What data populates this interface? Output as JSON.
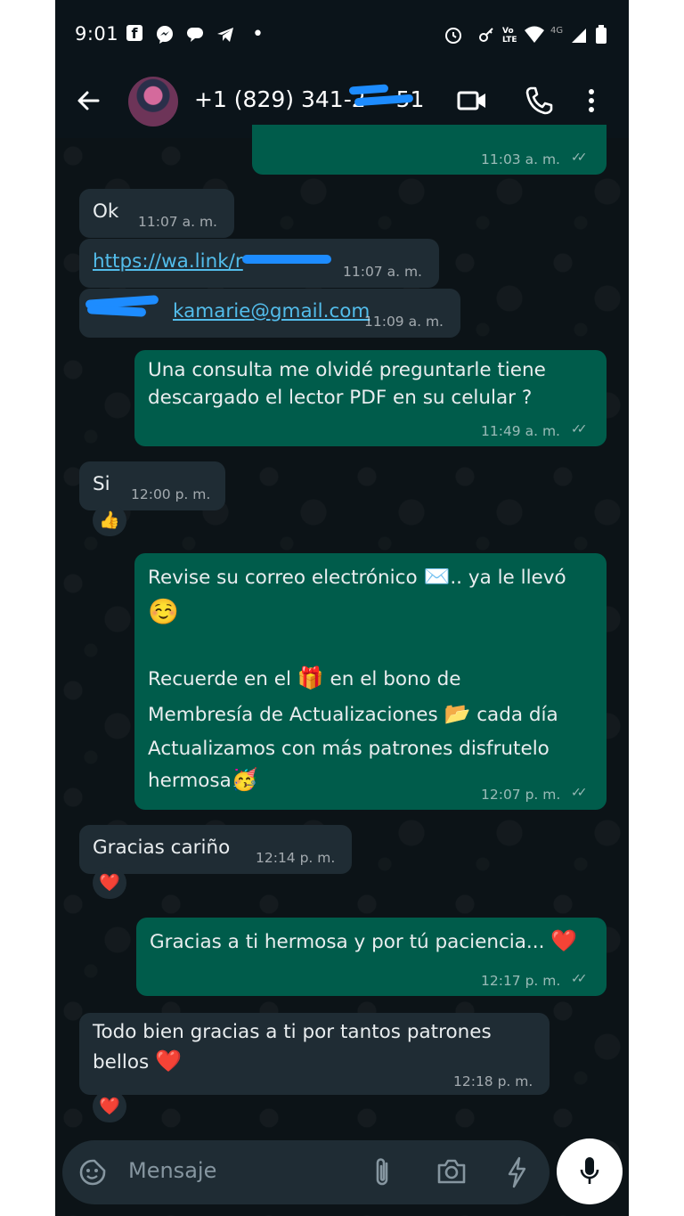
{
  "status_bar": {
    "time": "9:01",
    "network": "4G"
  },
  "header": {
    "contact_name": "+1 (829) 341-2",
    "contact_name_tail": "51"
  },
  "messages": [
    {
      "time": "11:03 a. m."
    },
    {
      "text": "Ok",
      "time": "11:07 a. m."
    },
    {
      "text": "https://wa.link/r",
      "time": "11:07 a. m."
    },
    {
      "text": "kamarie@gmail.com",
      "time": "11:09 a. m."
    },
    {
      "text": "Una consulta me olvidé preguntarle tiene\ndescargado el lector PDF en su celular ?",
      "time": "11:49 a. m."
    },
    {
      "text": "Si",
      "time": "12:00 p. m.",
      "reaction": "👍"
    },
    {
      "line1": "Revise su correo electrónico ",
      "line1_tail": ".. ya le llevó",
      "line2": "Recuerde en el ",
      "line2_tail": " en el bono de",
      "line3": "Membresía de Actualizaciones ",
      "line3_tail": " cada día",
      "line4": "Actualizamos con más patrones disfrutelo",
      "line5": "hermosa",
      "emoji_envelope": "✉️",
      "emoji_smile": "☺️",
      "emoji_gift": "🎁",
      "emoji_folder": "📂",
      "emoji_party": "🥳",
      "time": "12:07 p. m."
    },
    {
      "text": "Gracias cariño",
      "time": "12:14 p. m.",
      "reaction": "❤️"
    },
    {
      "text": "Gracias a ti hermosa y por tú paciencia... ",
      "emoji": "❤️",
      "time": "12:17 p. m."
    },
    {
      "line1": "Todo bien gracias a ti por tantos patrones",
      "line2": "bellos ",
      "emoji": "❤️",
      "time": "12:18 p. m.",
      "reaction": "❤️"
    }
  ],
  "composer": {
    "placeholder": "Mensaje"
  },
  "colors": {
    "incoming": "#1f2c34",
    "outgoing": "#005c4b",
    "link": "#53bdeb",
    "redaction": "#1d8cff"
  }
}
